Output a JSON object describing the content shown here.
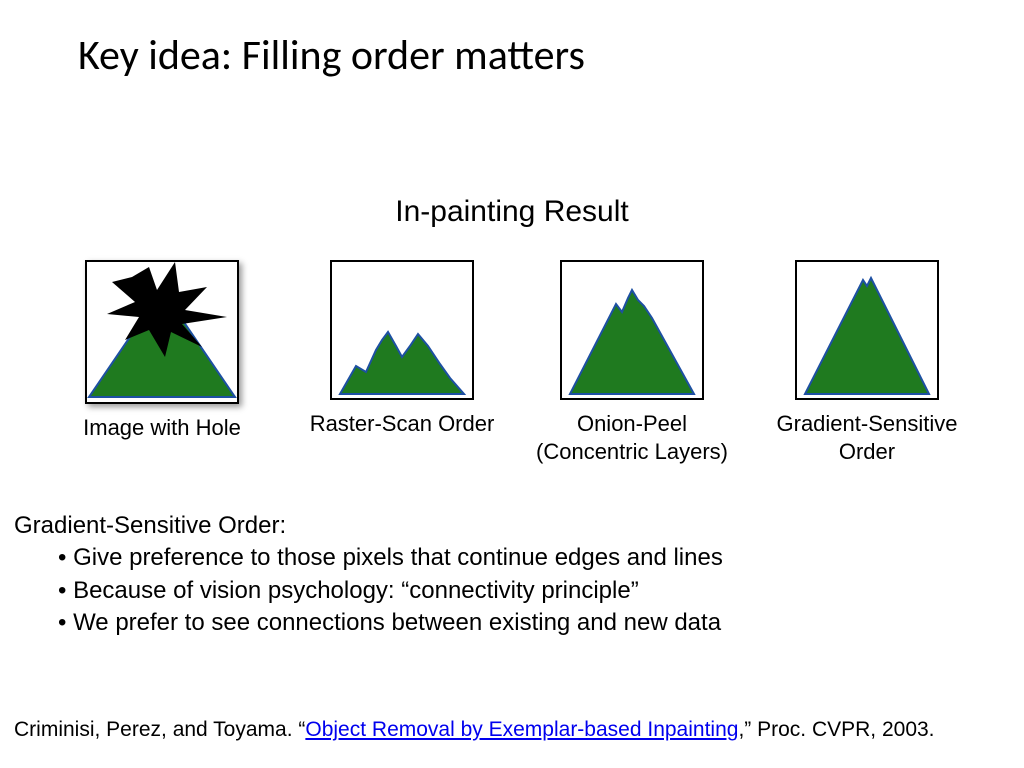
{
  "title": "Key idea: Filling order matters",
  "subtitle": "In-painting Result",
  "figures": {
    "hole": {
      "caption": "Image with Hole"
    },
    "raster": {
      "caption": "Raster-Scan Order"
    },
    "onion": {
      "caption1": "Onion-Peel",
      "caption2": "(Concentric Layers)"
    },
    "grad": {
      "caption1": "Gradient-Sensitive",
      "caption2": "Order"
    }
  },
  "body": {
    "heading": "Gradient-Sensitive Order:",
    "bullets": [
      "Give preference to those pixels that continue edges and lines",
      "Because of vision psychology:  “connectivity principle”",
      "We prefer to see connections between existing and new data"
    ]
  },
  "citation": {
    "prefix": "Criminisi, Perez, and Toyama. “",
    "link_text": "Object Removal by Exemplar-based Inpainting",
    "suffix": ",” Proc. CVPR, 2003."
  },
  "colors": {
    "green": "#1f7a1f",
    "stroke": "#1d50a2"
  }
}
